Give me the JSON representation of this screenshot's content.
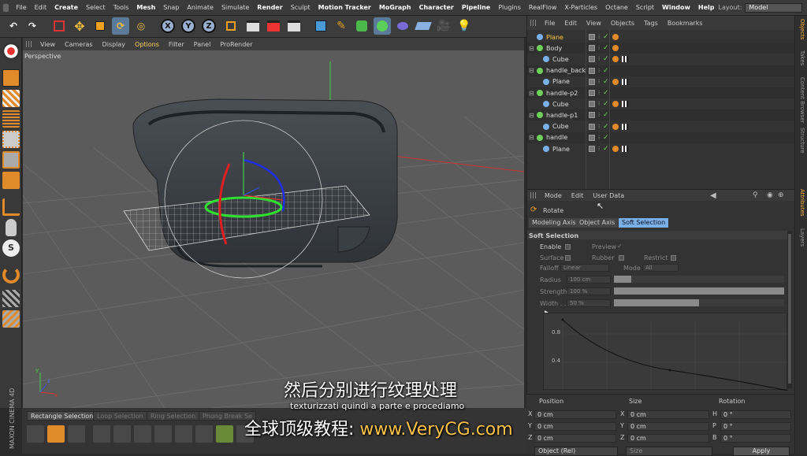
{
  "menubar": {
    "items": [
      "File",
      "Edit",
      "Create",
      "Select",
      "Tools",
      "Mesh",
      "Snap",
      "Animate",
      "Simulate",
      "Render",
      "Sculpt",
      "Motion Tracker",
      "MoGraph",
      "Character",
      "Pipeline",
      "Plugins",
      "RealFlow",
      "X-Particles",
      "Octane",
      "Script",
      "Window",
      "Help"
    ],
    "layout_label": "Layout:",
    "layout_value": "Model"
  },
  "toolbar": {
    "axis_x": "X",
    "axis_y": "Y",
    "axis_z": "Z",
    "icons": [
      "undo-icon",
      "redo-icon",
      "live-selection-icon",
      "move-icon",
      "scale-icon",
      "rotate-icon",
      "recent-tools-icon",
      "axis-x-icon",
      "axis-y-icon",
      "axis-z-icon",
      "coordinate-system-icon",
      "render-view-icon",
      "render-picture-viewer-icon",
      "render-settings-icon",
      "cube-primitive-icon",
      "pen-spline-icon",
      "subdivision-icon",
      "cloner-icon",
      "deformer-icon",
      "floor-environment-icon",
      "camera-icon",
      "light-icon"
    ]
  },
  "viewport": {
    "menu": [
      "View",
      "Cameras",
      "Display",
      "Options",
      "Filter",
      "Panel",
      "ProRender"
    ],
    "highlighted": "Options",
    "camera_label": "Perspective"
  },
  "subtitles": {
    "chinese": "然后分别进行纹理处理",
    "italian": "texturizzati quindi a parte e procediamo",
    "watermark_prefix": "全球顶级教程: ",
    "watermark_url": "www.VeryCG.com"
  },
  "bottom": {
    "maxon_label": "MAXON CINEMA 4D",
    "tabs": [
      "Rectangle Selection",
      "Loop Selection",
      "Ring Selection",
      "Phong Break Se"
    ]
  },
  "objects": {
    "menu": [
      "File",
      "Edit",
      "View",
      "Objects",
      "Tags",
      "Bookmarks"
    ],
    "rows": [
      {
        "name": "Plane",
        "indent": 0,
        "highlight": true,
        "icon_color": "#7ab0e8",
        "tags": [
          "ph"
        ]
      },
      {
        "name": "Body",
        "indent": 0,
        "highlight": false,
        "icon_color": "#6fd05a",
        "tags": [
          "ph"
        ]
      },
      {
        "name": "Cube",
        "indent": 1,
        "highlight": false,
        "icon_color": "#7ab0e8",
        "tags": [
          "ph",
          "chk2"
        ]
      },
      {
        "name": "handle_back",
        "indent": 0,
        "highlight": false,
        "icon_color": "#6fd05a",
        "tags": []
      },
      {
        "name": "Plane",
        "indent": 1,
        "highlight": false,
        "icon_color": "#7ab0e8",
        "tags": [
          "ph",
          "chk2"
        ]
      },
      {
        "name": "handle-p2",
        "indent": 0,
        "highlight": false,
        "icon_color": "#6fd05a",
        "tags": []
      },
      {
        "name": "Cube",
        "indent": 1,
        "highlight": false,
        "icon_color": "#7ab0e8",
        "tags": [
          "ph",
          "chk2"
        ]
      },
      {
        "name": "handle-p1",
        "indent": 0,
        "highlight": false,
        "icon_color": "#6fd05a",
        "tags": []
      },
      {
        "name": "Cube",
        "indent": 1,
        "highlight": false,
        "icon_color": "#7ab0e8",
        "tags": [
          "ph",
          "chk2"
        ]
      },
      {
        "name": "handle",
        "indent": 0,
        "highlight": false,
        "icon_color": "#6fd05a",
        "tags": []
      },
      {
        "name": "Plane",
        "indent": 1,
        "highlight": false,
        "icon_color": "#7ab0e8",
        "tags": [
          "ph",
          "chk2"
        ]
      }
    ]
  },
  "attributes": {
    "menu": [
      "Mode",
      "Edit",
      "User Data"
    ],
    "tool_name": "Rotate",
    "tabs": [
      "Modeling Axis",
      "Object Axis",
      "Soft Selection"
    ],
    "active_tab": "Soft Selection",
    "section": "Soft Selection",
    "enable": "Enable",
    "preview": "Preview",
    "preview_check": "✓",
    "surface": "Surface",
    "rubber": "Rubber",
    "restrict": "Restrict",
    "falloff_label": "Falloff",
    "falloff_value": "Linear",
    "mode_label": "Mode",
    "mode_value": "All",
    "radius_label": "Radius",
    "radius_value": "100 cm",
    "strength_label": "Strength",
    "strength_value": "100 %",
    "strength_level": 1.0,
    "width_label": "Width . .",
    "width_value": "50 %",
    "width_level": 0.5,
    "graph_y_labels": [
      "0.8",
      "0.4"
    ]
  },
  "coordinates": {
    "headers": [
      "Position",
      "Size",
      "Rotation"
    ],
    "rows": [
      {
        "axis": "X",
        "pos": "0 cm",
        "size_axis": "X",
        "size": "0 cm",
        "rot_axis": "H",
        "rot": "0 °"
      },
      {
        "axis": "Y",
        "pos": "0 cm",
        "size_axis": "Y",
        "size": "0 cm",
        "rot_axis": "P",
        "rot": "0 °"
      },
      {
        "axis": "Z",
        "pos": "0 cm",
        "size_axis": "Z",
        "size": "0 cm",
        "rot_axis": "B",
        "rot": "0 °"
      }
    ],
    "mode_dropdown": "Object (Rel)",
    "size_dropdown": "Size",
    "apply_label": "Apply"
  },
  "right_tabs": [
    "Objects",
    "Takes",
    "Content Browser",
    "Structure",
    "Attributes",
    "Layers"
  ],
  "right_tabs_active": [
    "Objects",
    "Attributes"
  ]
}
